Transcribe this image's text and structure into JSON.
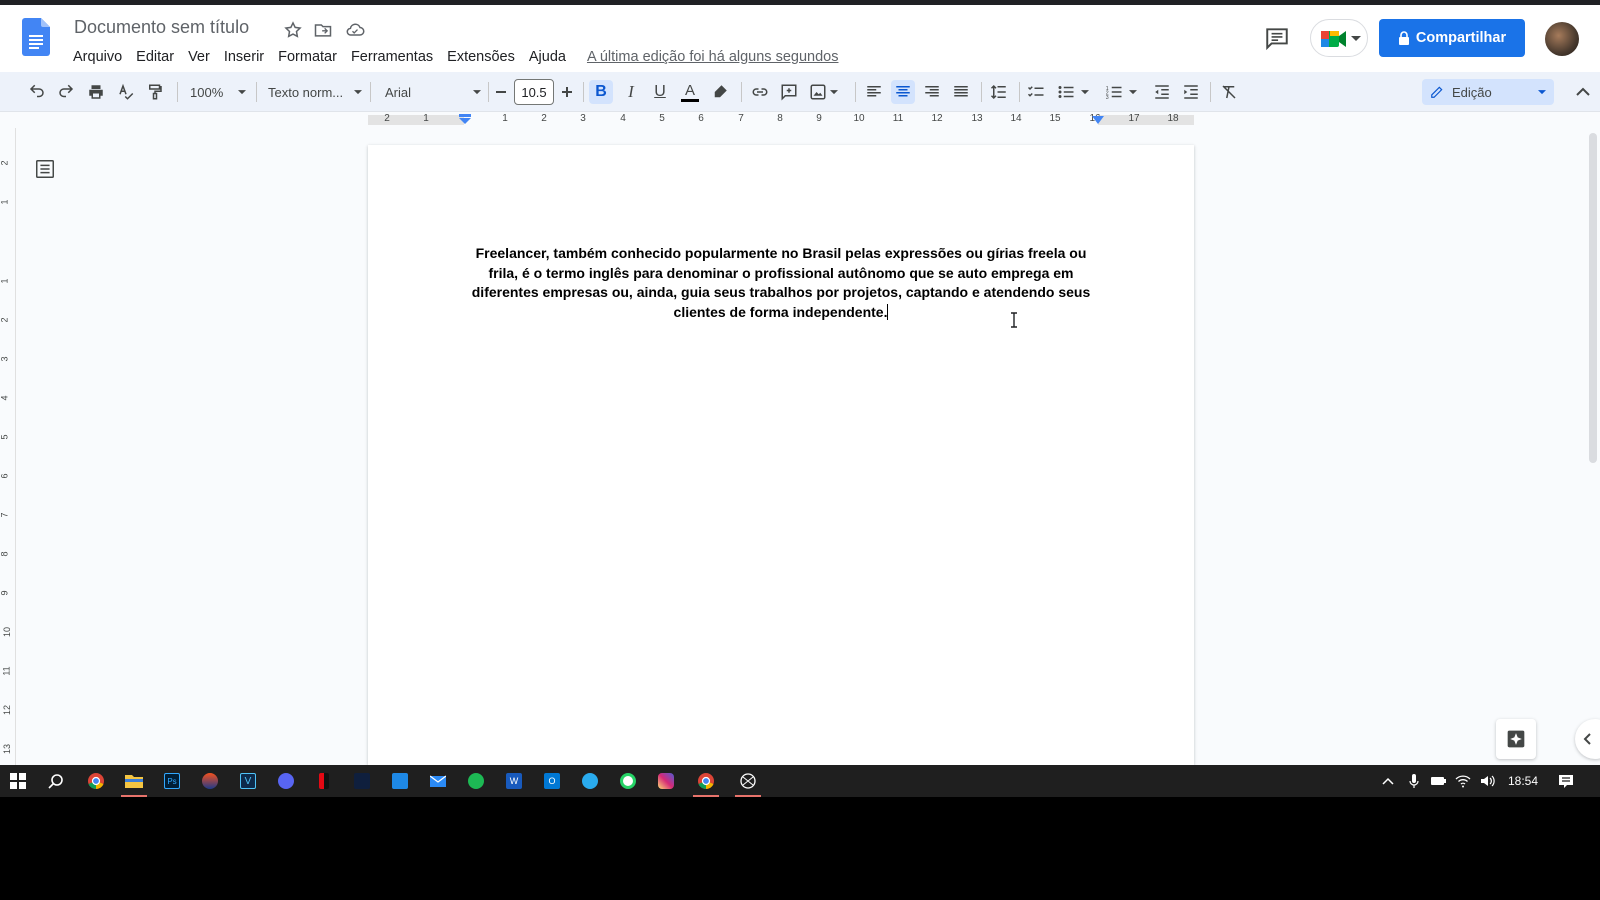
{
  "document": {
    "title": "Documento sem título",
    "body": "Freelancer, também conhecido popularmente no Brasil pelas expressões ou gírias freela ou frila, é o termo inglês para denominar o profissional autônomo que se auto emprega em diferentes empresas ou, ainda, guia seus trabalhos por projetos, captando e atendendo seus clientes de forma independente."
  },
  "menu": {
    "items": [
      "Arquivo",
      "Editar",
      "Ver",
      "Inserir",
      "Formatar",
      "Ferramentas",
      "Extensões",
      "Ajuda"
    ],
    "last_edit": "A última edição foi há alguns segundos"
  },
  "header": {
    "share_label": "Compartilhar",
    "icons": [
      "docs-logo-icon",
      "star-icon",
      "move-folder-icon",
      "cloud-saved-icon",
      "comments-icon",
      "meet-icon",
      "lock-icon",
      "avatar"
    ]
  },
  "toolbar": {
    "zoom": "100%",
    "style": "Texto norm...",
    "font": "Arial",
    "font_size": "10.5",
    "mode": "Edição",
    "bold_active": true,
    "alignment": "center",
    "text_color": "#000000"
  },
  "ruler": {
    "horizontal": [
      "2",
      "1",
      "1",
      "2",
      "3",
      "4",
      "5",
      "6",
      "7",
      "8",
      "9",
      "10",
      "11",
      "12",
      "13",
      "14",
      "15",
      "16",
      "17",
      "18"
    ],
    "vertical": [
      "2",
      "1",
      "1",
      "2",
      "3",
      "4",
      "5",
      "6",
      "7",
      "8",
      "9",
      "10",
      "11",
      "12",
      "13"
    ]
  },
  "taskbar": {
    "clock": "18:54",
    "apps": [
      "windows-start-icon",
      "search-icon",
      "chrome-icon",
      "file-explorer-icon",
      "photoshop-icon",
      "app-icon",
      "visual-icon",
      "discord-icon",
      "netflix-icon",
      "prime-video-icon",
      "app-icon",
      "mail-icon",
      "spotify-icon",
      "word-icon",
      "outlook-icon",
      "telegram-icon",
      "whatsapp-icon",
      "instagram-icon",
      "chrome-icon",
      "app-icon"
    ]
  },
  "colors": {
    "accent": "#1a73e8",
    "toolbar_bg": "#edf2fa",
    "active_button": "#d3e3fd",
    "canvas_bg": "#f9fbfd"
  }
}
